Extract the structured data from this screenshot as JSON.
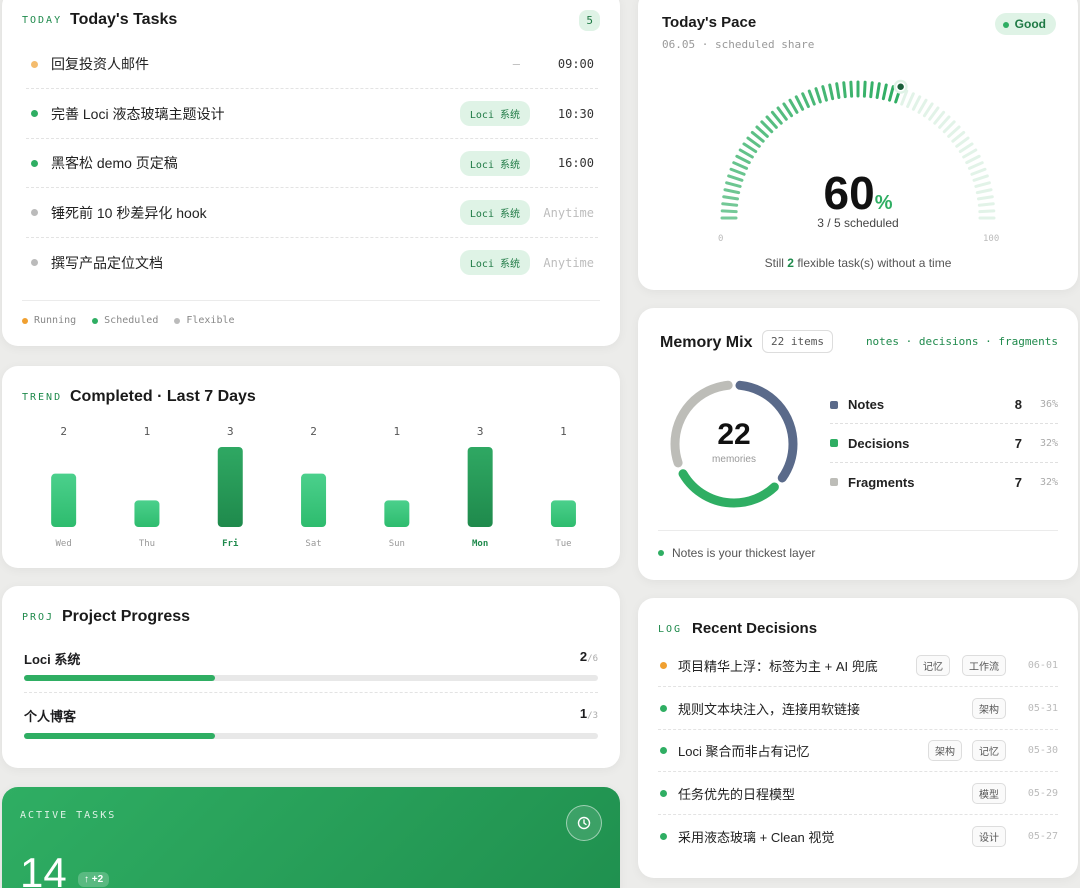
{
  "tasks": {
    "tag": "TODAY",
    "title": "Today's Tasks",
    "count": "5",
    "items": [
      {
        "text": "回复投资人邮件",
        "tag": "",
        "dash": "–",
        "time": "09:00",
        "status": "running"
      },
      {
        "text": "完善 Loci 液态玻璃主题设计",
        "tag": "Loci 系统",
        "time": "10:30",
        "status": "scheduled"
      },
      {
        "text": "黑客松 demo 页定稿",
        "tag": "Loci 系统",
        "time": "16:00",
        "status": "scheduled"
      },
      {
        "text": "锤死前 10 秒差异化 hook",
        "tag": "Loci 系统",
        "time": "Anytime",
        "status": "flexible"
      },
      {
        "text": "撰写产品定位文档",
        "tag": "Loci 系统",
        "time": "Anytime",
        "status": "flexible"
      }
    ],
    "legend": [
      {
        "label": "Running",
        "color": "#f0a030"
      },
      {
        "label": "Scheduled",
        "color": "#2fae63"
      },
      {
        "label": "Flexible",
        "color": "#bbbbbb"
      }
    ]
  },
  "trend": {
    "tag": "TREND",
    "title": "Completed · Last 7 Days"
  },
  "chart_data": {
    "type": "bar",
    "categories": [
      "Wed",
      "Thu",
      "Fri",
      "Sat",
      "Sun",
      "Mon",
      "Tue"
    ],
    "values": [
      2,
      1,
      3,
      2,
      1,
      3,
      1
    ],
    "highlight": [
      "Fri",
      "Mon"
    ],
    "ylim": [
      0,
      3
    ]
  },
  "project": {
    "tag": "PROJ",
    "title": "Project Progress",
    "items": [
      {
        "name": "Loci 系统",
        "done": "2",
        "total": "/6",
        "progress": 0.333
      },
      {
        "name": "个人博客",
        "done": "1",
        "total": "/3",
        "progress": 0.333
      }
    ]
  },
  "active": {
    "label": "ACTIVE TASKS",
    "count": "14",
    "delta": "↑ +2"
  },
  "pace": {
    "title": "Today's Pace",
    "badge": "Good",
    "subtitle": "06.05 · scheduled share",
    "value": "60",
    "unit": "%",
    "percent": 60,
    "scheduled": "3 / 5 scheduled",
    "min": "0",
    "max": "100",
    "footer_pre": "Still ",
    "footer_num": "2",
    "footer_post": " flexible task(s) without a time"
  },
  "memory": {
    "title": "Memory Mix",
    "count_badge": "22 items",
    "links": "notes · decisions · fragments",
    "total": "22",
    "total_label": "memories",
    "items": [
      {
        "name": "Notes",
        "count": "8",
        "pct": "36%",
        "color": "#5a6a8a",
        "value": 8
      },
      {
        "name": "Decisions",
        "count": "7",
        "pct": "32%",
        "color": "#2fae63",
        "value": 7
      },
      {
        "name": "Fragments",
        "count": "7",
        "pct": "32%",
        "color": "#bdbdb8",
        "value": 7
      }
    ],
    "footer": "Notes is your thickest layer"
  },
  "log": {
    "tag": "LOG",
    "title": "Recent Decisions",
    "items": [
      {
        "text": "项目精华上浮：标签为主 + AI 兜底",
        "tags": [
          "记忆",
          "工作流"
        ],
        "date": "06-01",
        "color": "#f0a030"
      },
      {
        "text": "规则文本块注入，连接用软链接",
        "tags": [
          "架构"
        ],
        "date": "05-31",
        "color": "#2fae63"
      },
      {
        "text": "Loci 聚合而非占有记忆",
        "tags": [
          "架构",
          "记忆"
        ],
        "date": "05-30",
        "color": "#2fae63"
      },
      {
        "text": "任务优先的日程模型",
        "tags": [
          "模型"
        ],
        "date": "05-29",
        "color": "#2fae63"
      },
      {
        "text": "采用液态玻璃 + Clean 视觉",
        "tags": [
          "设计"
        ],
        "date": "05-27",
        "color": "#2fae63"
      }
    ]
  },
  "colors": {
    "accent": "#2fae63",
    "accent_dark": "#1f8a4c",
    "running": "#f0a030",
    "flexible": "#bbbbbb"
  }
}
